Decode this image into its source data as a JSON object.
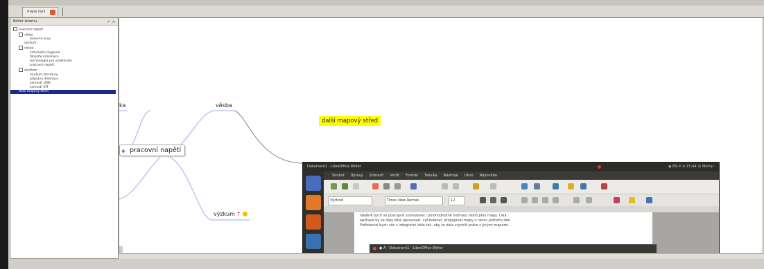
{
  "window": {
    "tab_label": "mapa nyni"
  },
  "sidebar": {
    "title": "Editor stromu",
    "header_buttons": "↗ ×",
    "tree": [
      {
        "label": "pracovní napětí",
        "level": 0,
        "toggle": true
      },
      {
        "label": "vštěa",
        "level": 1,
        "toggle": true
      },
      {
        "label": "barevné prvy",
        "level": 2
      },
      {
        "label": "výzkum",
        "level": 1
      },
      {
        "label": "věsba",
        "level": 1,
        "toggle": true
      },
      {
        "label": "informační hygiena",
        "level": 2
      },
      {
        "label": "filozofie informace",
        "level": 2
      },
      {
        "label": "technologie pro vzdělávání",
        "level": 2
      },
      {
        "label": "pracovní napětí",
        "level": 2
      },
      {
        "label": "studium",
        "level": 1,
        "toggle": true
      },
      {
        "label": "studium literatury",
        "level": 2
      },
      {
        "label": "příprava disertace",
        "level": 2
      },
      {
        "label": "seminář ÚISK",
        "level": 2
      },
      {
        "label": "seminář KIT",
        "level": 2
      },
      {
        "label": "další mapový střed",
        "level": 0,
        "selected": true
      }
    ]
  },
  "mindmap": {
    "central_node": "pracovní napětí",
    "node_ka": "ka",
    "node_vyuka": "věsba",
    "node_vyzkum": "výzkum",
    "floating_node": "další mapový střed",
    "line_color": "#b9c8f0"
  },
  "libreoffice": {
    "title": "Dokument1 - LibreOffice Writer",
    "title_right": "◉ EN ✉ ≡ 15:44 ☺ Michal",
    "menu": [
      "Soubor",
      "Úpravy",
      "Zobrazit",
      "Vložit",
      "Formát",
      "Tabulka",
      "Nástroje",
      "Okno",
      "Nápověda"
    ],
    "style_field": "Výchozí",
    "font_field": "Times New Roman",
    "size_field": "12",
    "doc_lines": [
      "Ideálně bych se postupně zobrazovat i plnohodnotné hodnoty úkolů přes mapy. Celá",
      "aplikace by se dala dále úpravovat, vyhledávat, propojovat mapy v rámci jednoho dok",
      "Potřeboval bych věc s integrační dále tak, aby se dala zrychlit práce s jinými mapami."
    ],
    "dialog_title": "● A - Dokument1 - LibreOffice Writer"
  }
}
